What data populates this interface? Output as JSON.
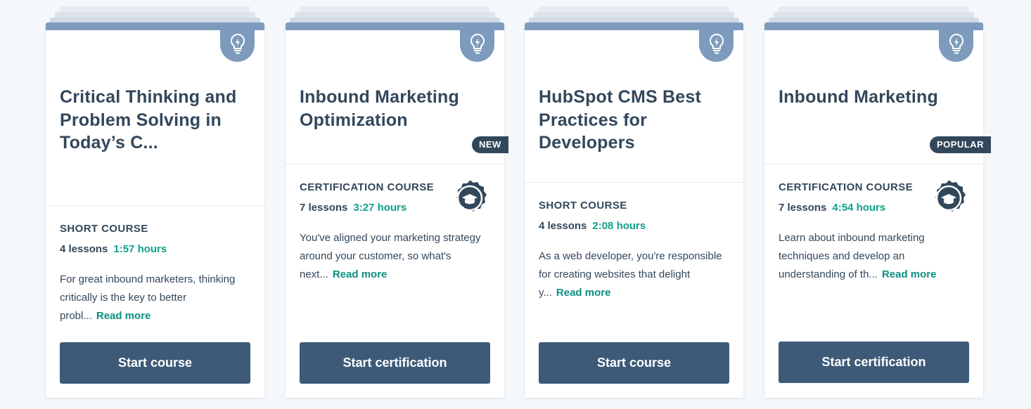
{
  "colors": {
    "header": "#7e9bbd",
    "title": "#33475b",
    "hours": "#0fa189",
    "link": "#0b8f82",
    "button": "#3d5a78",
    "badge": "#33475b"
  },
  "icons": {
    "course_icon": "lightbulb-icon",
    "cert_icon": "graduation-cap-seal-icon"
  },
  "cards": [
    {
      "title": "Critical Thinking and Problem Solving in Today’s C...",
      "type": "SHORT COURSE",
      "lessons": "4 lessons",
      "hours": "1:57 hours",
      "description": "For great inbound marketers, thinking critically is the key to better probl...",
      "read_more": "Read more",
      "button": "Start course"
    },
    {
      "title": "Inbound Marketing Optimization",
      "badge": "NEW",
      "type": "CERTIFICATION COURSE",
      "lessons": "7 lessons",
      "hours": "3:27 hours",
      "description": "You've aligned your marketing strategy around your customer, so what's next...",
      "read_more": "Read more",
      "button": "Start certification"
    },
    {
      "title": "HubSpot CMS Best Practices for Developers",
      "type": "SHORT COURSE",
      "lessons": "4 lessons",
      "hours": "2:08 hours",
      "description": "As a web developer, you're responsible for creating websites that delight y...",
      "read_more": "Read more",
      "button": "Start course"
    },
    {
      "title": "Inbound Marketing",
      "badge": "POPULAR",
      "type": "CERTIFICATION COURSE",
      "lessons": "7 lessons",
      "hours": "4:54 hours",
      "description": "Learn about inbound marketing techniques and develop an understanding of th...",
      "read_more": "Read more",
      "button": "Start certification"
    }
  ]
}
